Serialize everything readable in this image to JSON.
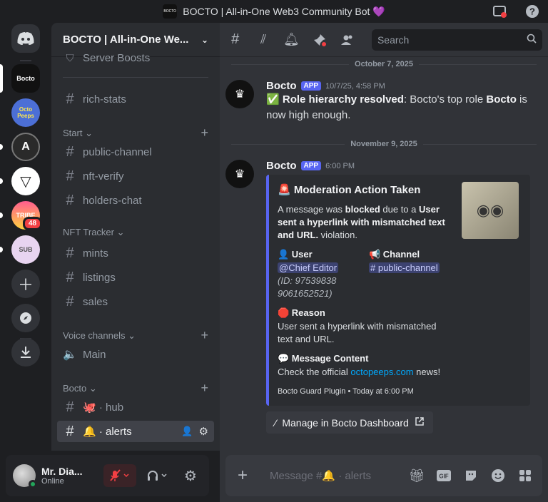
{
  "window": {
    "title": "BOCTO | All-in-One Web3 Community Bot 💜",
    "favicon_text": "BOCTO"
  },
  "servers": [
    {
      "name": "Discord Home",
      "label": ""
    },
    {
      "name": "Bocto",
      "label": "Bocto"
    },
    {
      "name": "Octo Peeps",
      "label": "Octo Peeps"
    },
    {
      "name": "Server A",
      "label": "A"
    },
    {
      "name": "Server Triangle",
      "label": "▽"
    },
    {
      "name": "Tribe",
      "label": "TRIBE",
      "badge": "48"
    },
    {
      "name": "Sub",
      "label": "SUB"
    }
  ],
  "sidebar": {
    "server_name": "BOCTO | All-in-One We...",
    "partial_item": "Server Boosts",
    "items": [
      {
        "type": "channel",
        "label": "rich-stats"
      },
      {
        "type": "category",
        "label": "Start"
      },
      {
        "type": "channel",
        "label": "public-channel"
      },
      {
        "type": "channel",
        "label": "nft-verify"
      },
      {
        "type": "channel",
        "label": "holders-chat"
      },
      {
        "type": "category",
        "label": "NFT Tracker"
      },
      {
        "type": "channel",
        "label": "mints"
      },
      {
        "type": "channel",
        "label": "listings"
      },
      {
        "type": "channel",
        "label": "sales"
      },
      {
        "type": "category",
        "label": "Voice channels"
      },
      {
        "type": "voice",
        "label": "Main"
      },
      {
        "type": "category",
        "label": "Bocto"
      },
      {
        "type": "channel",
        "label": "🐙 · hub"
      },
      {
        "type": "channel",
        "label": "🔔 · alerts",
        "selected": true
      }
    ]
  },
  "user": {
    "name": "Mr. Dia...",
    "status": "Online"
  },
  "header": {
    "search_placeholder": "Search"
  },
  "messages": [
    {
      "divider": "October 7, 2025",
      "author": "Bocto",
      "tag": "APP",
      "timestamp": "10/7/25, 4:58 PM",
      "emoji": "✅",
      "bold_lead": "Role hierarchy resolved",
      "text_a": ": Bocto's top role ",
      "bold_mid": "Bocto",
      "text_b": " is now high enough."
    },
    {
      "divider": "November 9, 2025",
      "author": "Bocto",
      "tag": "APP",
      "timestamp": "6:00 PM",
      "embed": {
        "title": "🚨 Moderation Action Taken",
        "desc_a": "A message was ",
        "desc_b1": "blocked",
        "desc_c": " due to a ",
        "desc_b2": "User sent a hyperlink with mismatched text and URL.",
        "desc_d": " violation.",
        "user_field_name": "👤 User",
        "user_mention": "@Chief Editor",
        "user_id": "(ID: 975398389061652521)",
        "channel_field_name": "📢 Channel",
        "channel_mention": "# public-channel",
        "reason_name": "🛑 Reason",
        "reason_value": "User sent a hyperlink with mismatched text and URL.",
        "content_name": "💬 Message Content",
        "content_a": "Check the official ",
        "content_link": "octopeeps.com",
        "content_b": " news!",
        "footer": "Bocto Guard Plugin • Today at 6:00 PM"
      },
      "button": "Manage in Bocto Dashboard"
    }
  ],
  "composer": {
    "placeholder": "Message #🔔 · alerts"
  }
}
